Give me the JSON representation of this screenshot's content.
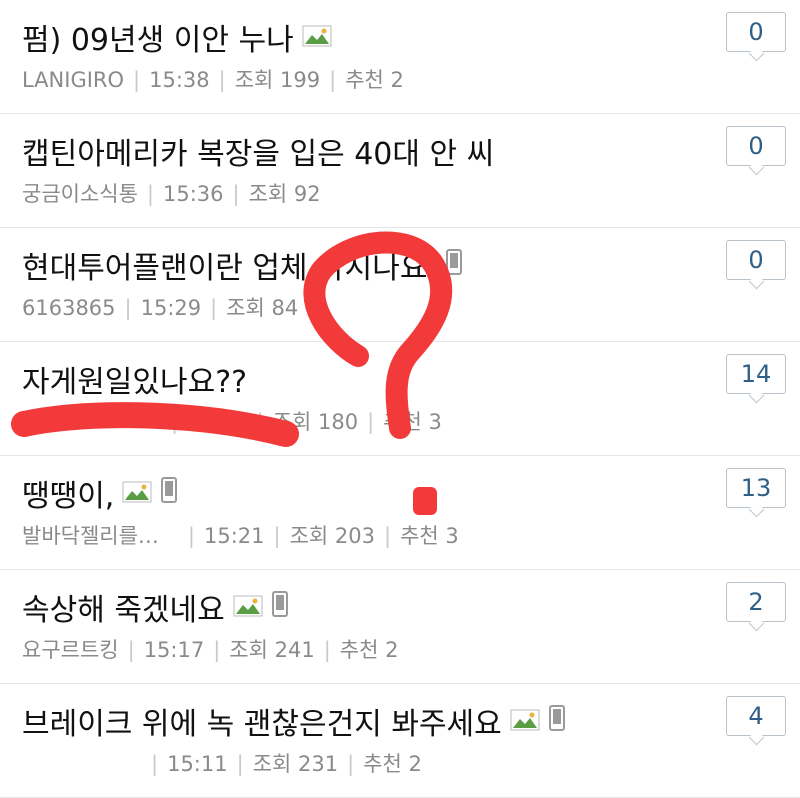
{
  "posts": [
    {
      "title": "펌) 09년생 이안 누나",
      "has_image": true,
      "has_mobile": false,
      "author": "LANIGIRO",
      "time": "15:38",
      "views": "조회 199",
      "recommend": "추천 2",
      "comments": "0"
    },
    {
      "title": "캡틴아메리카 복장을 입은 40대 안 씨",
      "has_image": false,
      "has_mobile": false,
      "author": "궁금이소식통",
      "time": "15:36",
      "views": "조회 92",
      "recommend": "",
      "comments": "0"
    },
    {
      "title": "현대투어플랜이란 업체 아시나요.",
      "has_image": false,
      "has_mobile": true,
      "author": "6163865",
      "time": "15:29",
      "views": "조회 84",
      "recommend": "",
      "comments": "0"
    },
    {
      "title": "자게원일있나요??",
      "has_image": false,
      "has_mobile": false,
      "author": "",
      "time": "15:22",
      "views": "조회 180",
      "recommend": "추천 3",
      "comments": "14"
    },
    {
      "title": "땡땡이,",
      "has_image": true,
      "has_mobile": true,
      "author": "발바닥젤리를…",
      "time": "15:21",
      "views": "조회 203",
      "recommend": "추천 3",
      "comments": "13"
    },
    {
      "title": "속상해 죽겠네요",
      "has_image": true,
      "has_mobile": true,
      "author": "요구르트킹",
      "time": "15:17",
      "views": "조회 241",
      "recommend": "추천 2",
      "comments": "2"
    },
    {
      "title": "브레이크 위에 녹 괜찮은건지 봐주세요",
      "has_image": true,
      "has_mobile": true,
      "author": "",
      "time": "15:11",
      "views": "조회 231",
      "recommend": "추천 2",
      "comments": "4"
    }
  ],
  "icons": {
    "image": "image-icon",
    "mobile": "mobile-icon"
  },
  "colors": {
    "badge_text": "#2f5f86",
    "scribble": "#f33a3a",
    "meta": "#8a8a8a"
  }
}
